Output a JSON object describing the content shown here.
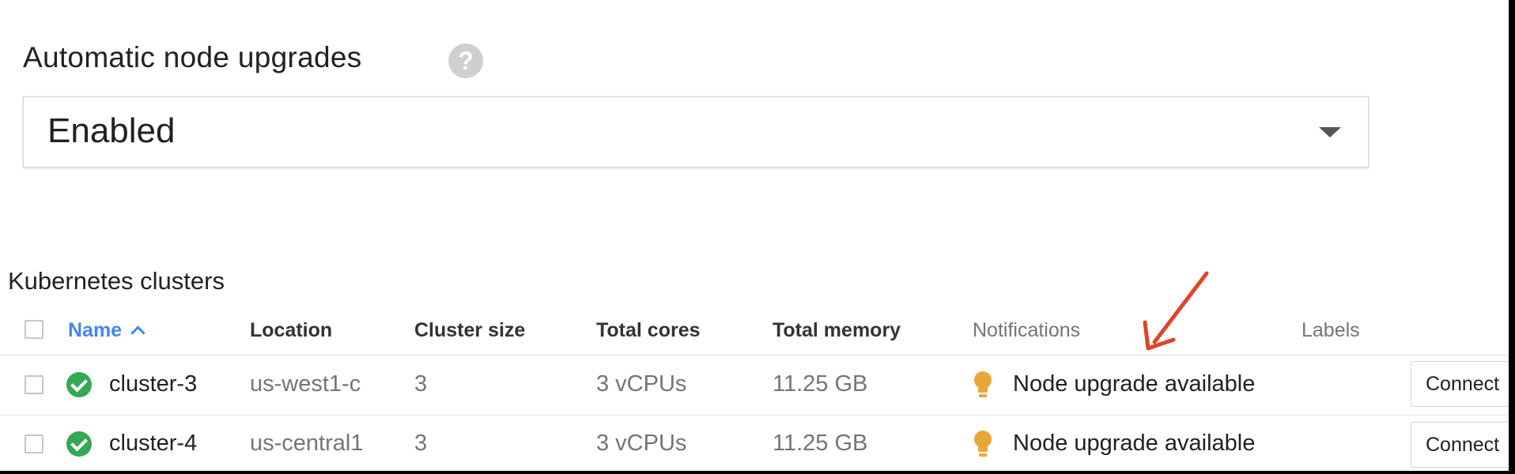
{
  "settings": {
    "auto_upgrade_label": "Automatic node upgrades",
    "help_glyph": "?",
    "auto_upgrade_value": "Enabled"
  },
  "clusters_table": {
    "title": "Kubernetes clusters",
    "columns": {
      "name": "Name",
      "location": "Location",
      "cluster_size": "Cluster size",
      "total_cores": "Total cores",
      "total_memory": "Total memory",
      "notifications": "Notifications",
      "labels": "Labels"
    },
    "sort": {
      "column": "Name",
      "direction": "ascending"
    },
    "rows": [
      {
        "status": "ok",
        "name": "cluster-3",
        "location": "us-west1-c",
        "cluster_size": "3",
        "total_cores": "3 vCPUs",
        "total_memory": "11.25 GB",
        "notification": "Node upgrade available",
        "action": "Connect"
      },
      {
        "status": "ok",
        "name": "cluster-4",
        "location": "us-central1",
        "cluster_size": "3",
        "total_cores": "3 vCPUs",
        "total_memory": "11.25 GB",
        "notification": "Node upgrade available",
        "action": "Connect"
      }
    ]
  },
  "colors": {
    "link_blue": "#4285f4",
    "status_green": "#34a853",
    "notification_amber": "#e7a83a",
    "annotation_arrow_red": "#e0442a"
  },
  "icons": {
    "help": "help-circle-icon",
    "dropdown": "dropdown-caret-icon",
    "sort": "sort-ascending-icon",
    "status": "check-circle-icon",
    "notification": "lightbulb-icon"
  }
}
